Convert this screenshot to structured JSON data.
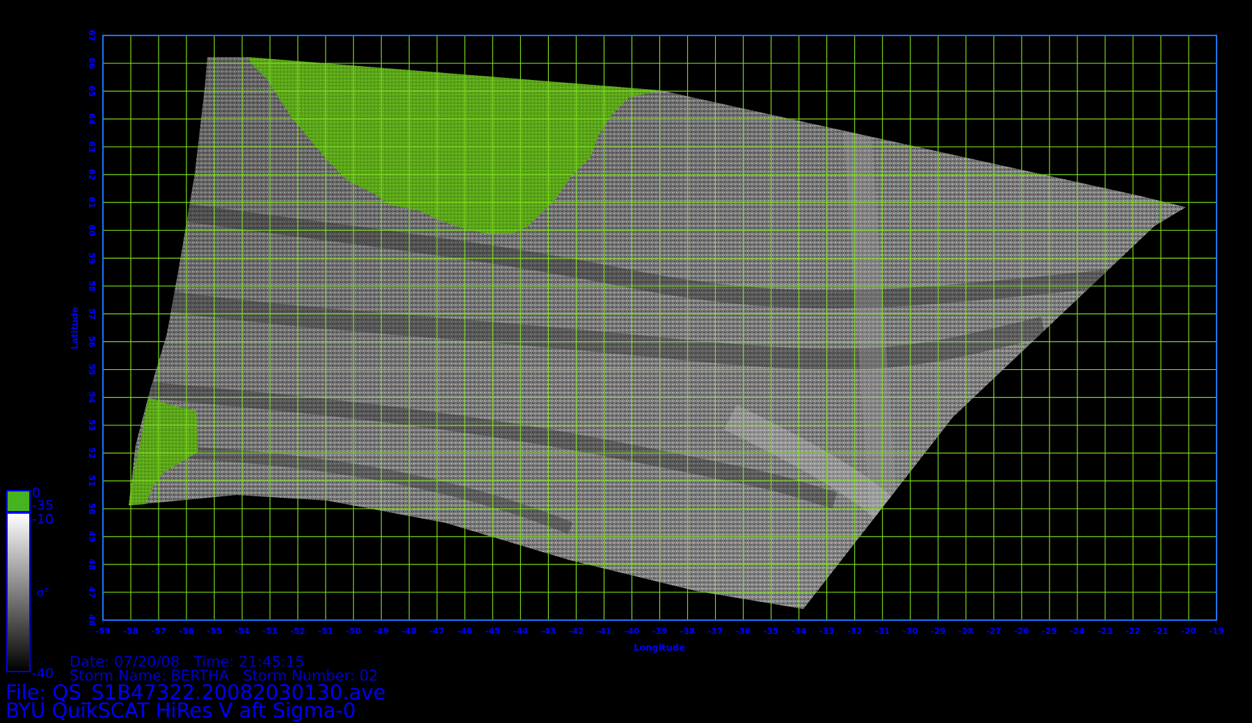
{
  "map": {
    "axes": {
      "x_label": "Longitude",
      "y_label": "Latitude",
      "lon_min": -59,
      "lon_max": -19,
      "lat_min": 46,
      "lat_max": 67,
      "lon_ticks": [
        -59,
        -58,
        -57,
        -56,
        -55,
        -54,
        -53,
        -52,
        -51,
        -50,
        -49,
        -48,
        -47,
        -46,
        -45,
        -44,
        -43,
        -42,
        -41,
        -40,
        -39,
        -38,
        -37,
        -36,
        -35,
        -34,
        -33,
        -32,
        -31,
        -30,
        -29,
        -28,
        -27,
        -26,
        -25,
        -24,
        -23,
        -22,
        -21,
        -20,
        -19
      ],
      "lat_ticks": [
        46,
        47,
        48,
        49,
        50,
        51,
        52,
        53,
        54,
        55,
        56,
        57,
        58,
        59,
        60,
        61,
        62,
        63,
        64,
        65,
        66,
        67
      ],
      "grid": true
    },
    "colors": {
      "background": "#000000",
      "grid": "#7ddc1e",
      "frame": "#1e78ff",
      "tick_text": "#0000ff",
      "land": "#5aa518",
      "colorbar_land": "#46b41e"
    },
    "colorbar": {
      "land_top": "0",
      "land_bottom": "-35",
      "top": "-10",
      "bottom": "-40",
      "units": "σ°"
    }
  },
  "info": {
    "date_line": "Date: 07/20/08   Time: 21:45:15",
    "storm_line": "Storm Name: BERTHA   Storm Number: 02",
    "file_line": "File: QS_S1B47322.20082030130.ave",
    "product_line": "BYU QuikSCAT HiRes V aft Sigma-0"
  }
}
